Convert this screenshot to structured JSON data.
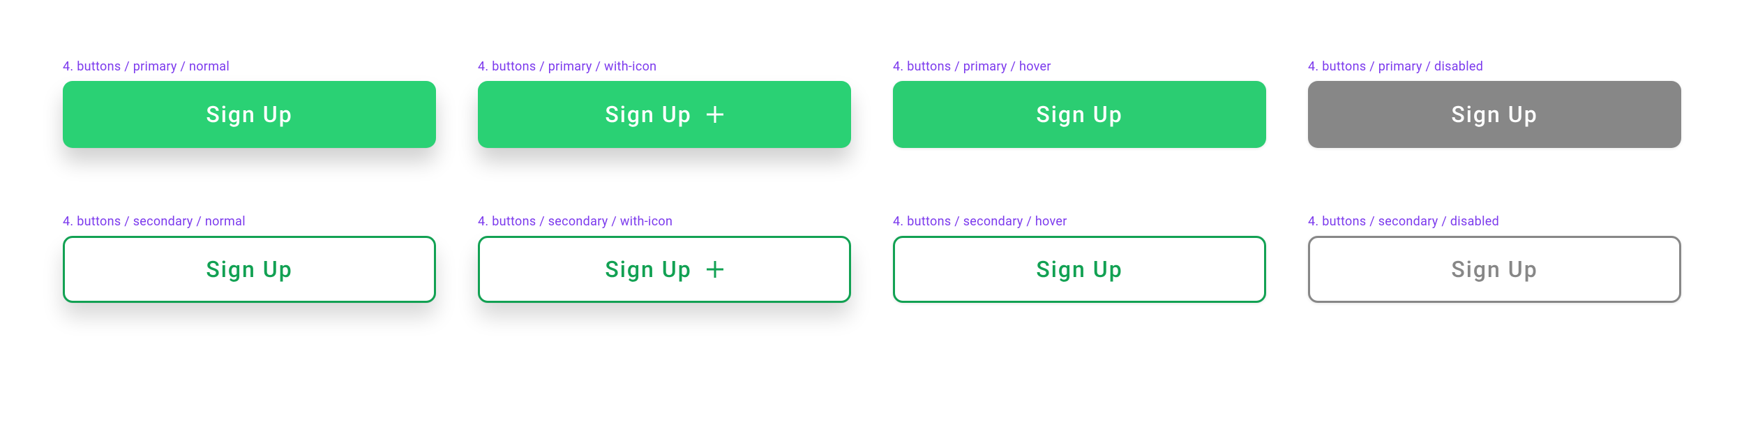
{
  "colors": {
    "primary": "#2ad174",
    "primaryHover": "#2bcd72",
    "secondaryBorder": "#12a153",
    "disabled": "#878787",
    "labelPurple": "#7c3aed"
  },
  "buttons": {
    "row1": [
      {
        "caption": "4. buttons / primary / normal",
        "label": "Sign Up",
        "icon": null
      },
      {
        "caption": "4. buttons / primary / with-icon",
        "label": "Sign Up",
        "icon": "plus"
      },
      {
        "caption": "4. buttons / primary / hover",
        "label": "Sign Up",
        "icon": null
      },
      {
        "caption": "4. buttons / primary / disabled",
        "label": "Sign Up",
        "icon": null
      }
    ],
    "row2": [
      {
        "caption": "4. buttons / secondary / normal",
        "label": "Sign Up",
        "icon": null
      },
      {
        "caption": "4. buttons / secondary / with-icon",
        "label": "Sign Up",
        "icon": "plus"
      },
      {
        "caption": "4. buttons / secondary / hover",
        "label": "Sign Up",
        "icon": null
      },
      {
        "caption": "4. buttons / secondary / disabled",
        "label": "Sign Up",
        "icon": null
      }
    ]
  }
}
